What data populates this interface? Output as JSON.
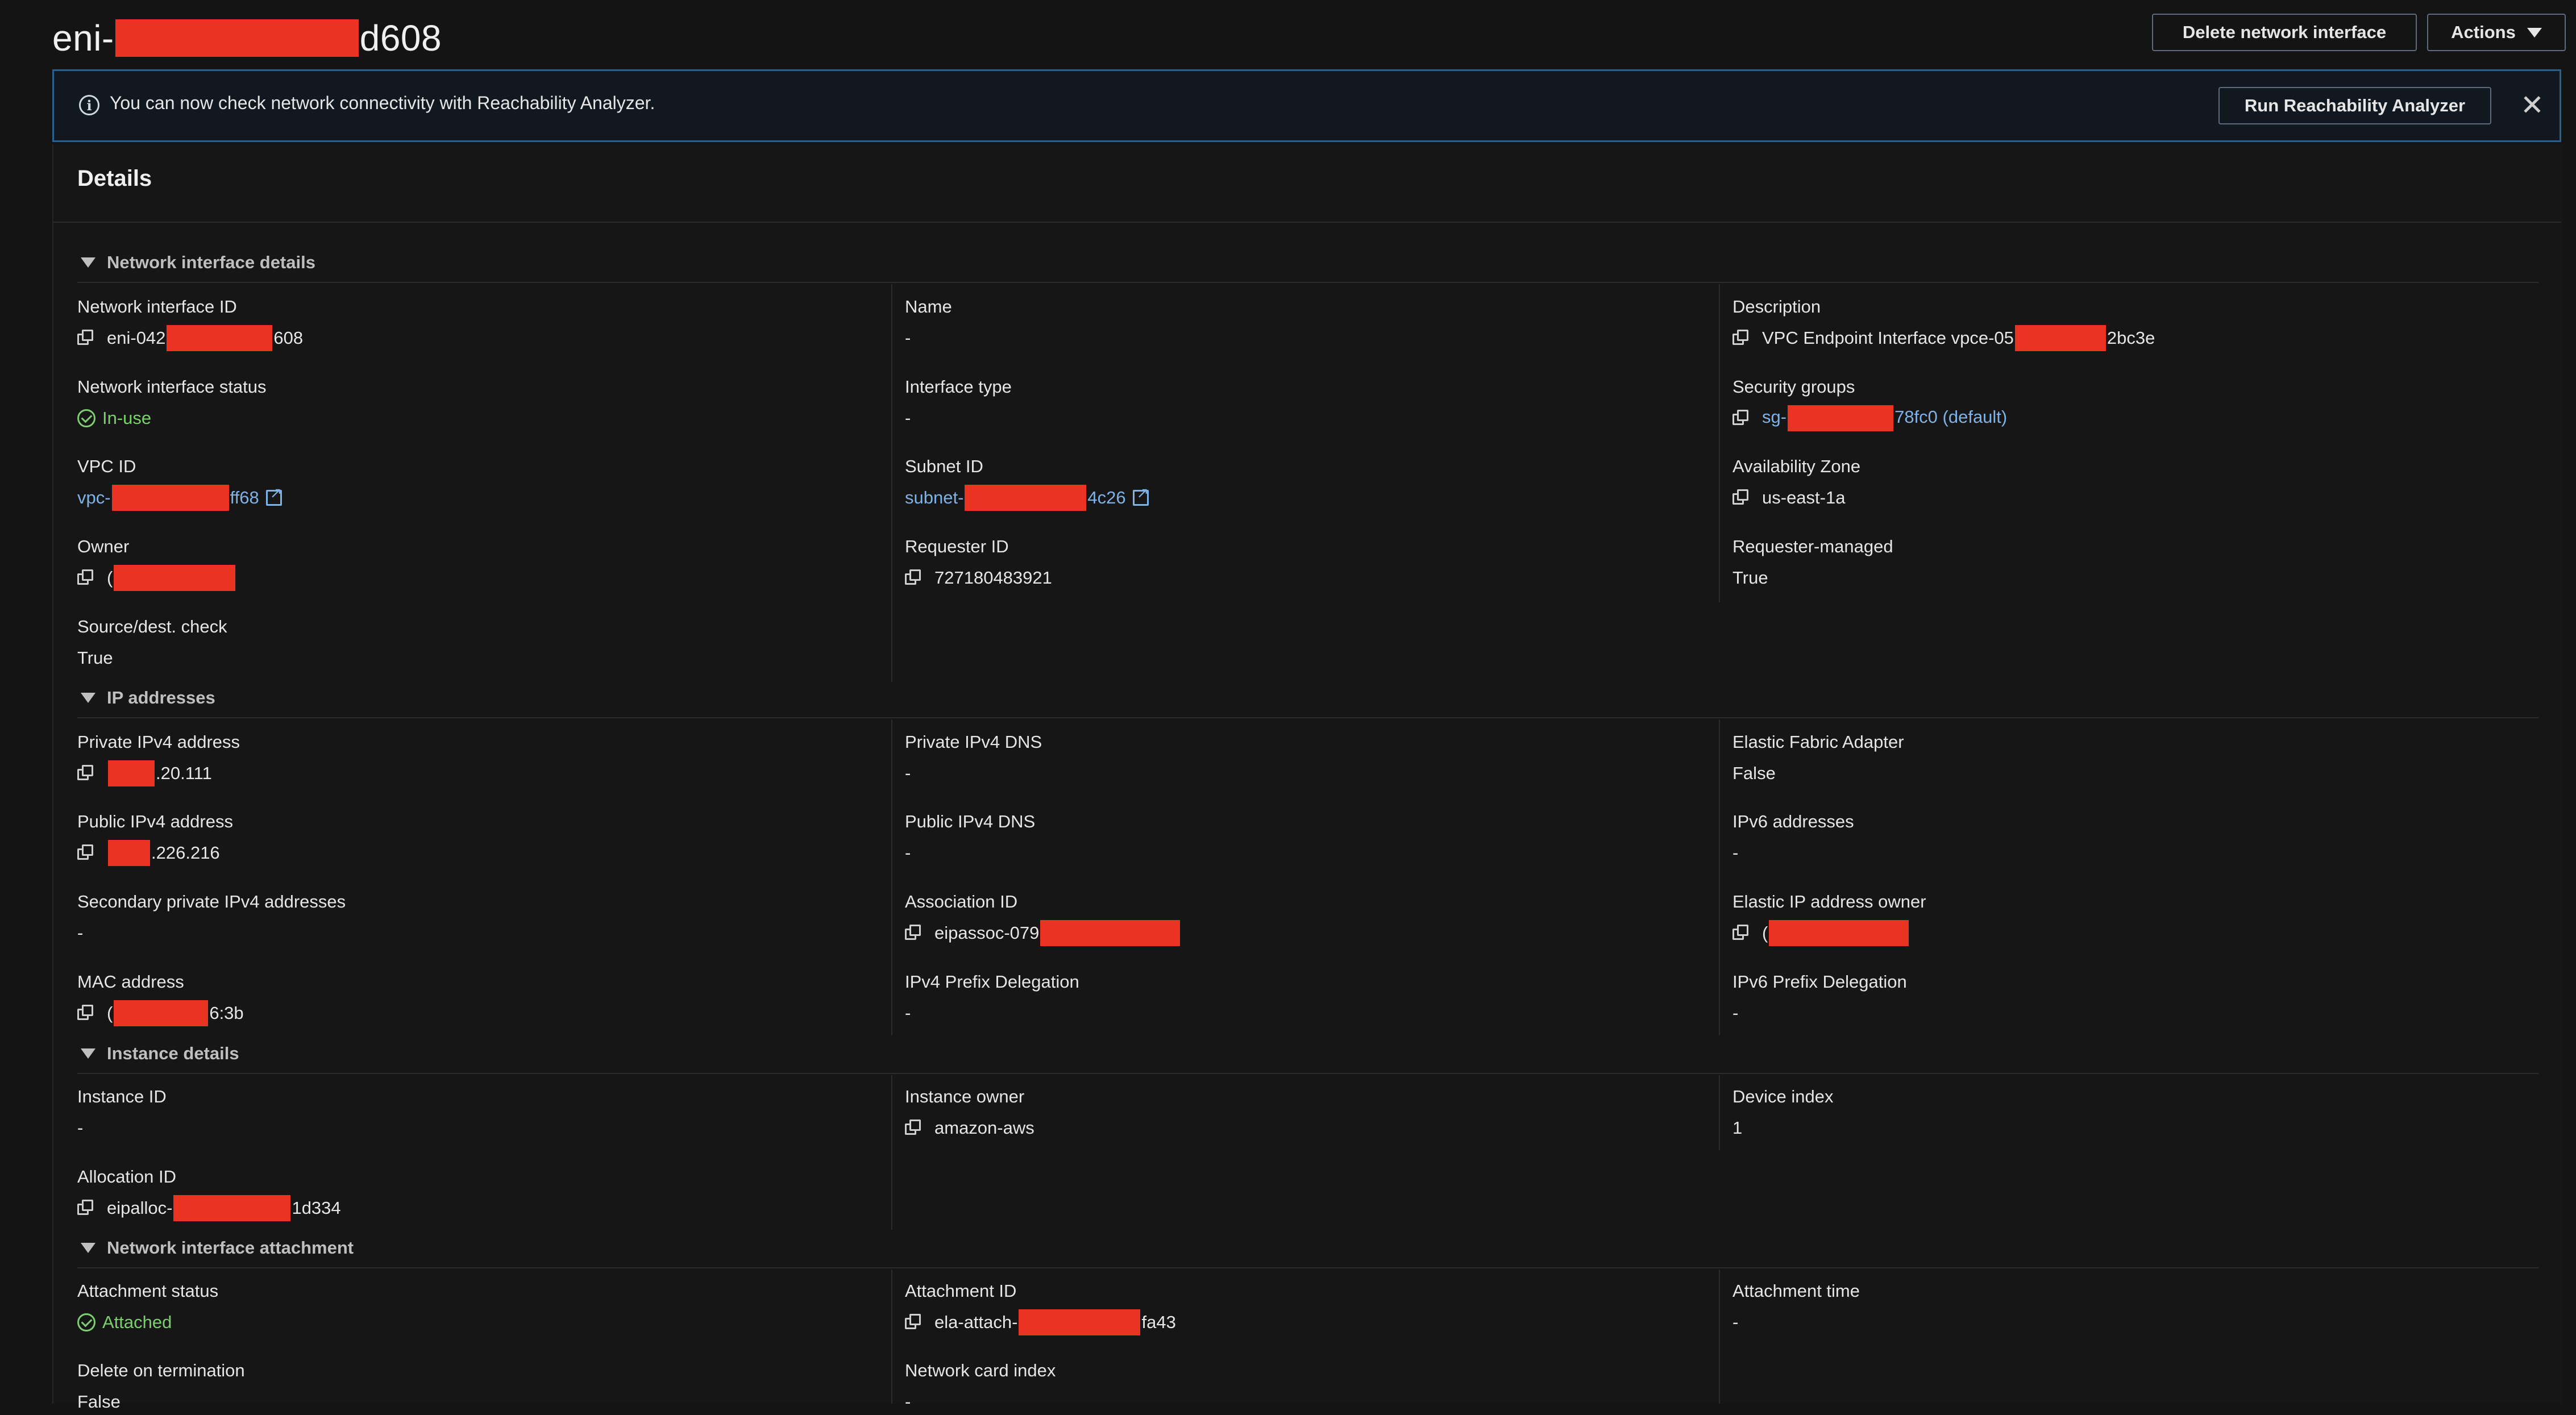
{
  "header": {
    "title_prefix": "eni-",
    "title_suffix": "d608",
    "delete_button": "Delete network interface",
    "actions_button": "Actions"
  },
  "banner": {
    "message": "You can now check network connectivity with Reachability Analyzer.",
    "run_button": "Run Reachability Analyzer"
  },
  "details_title": "Details",
  "sections": {
    "network_interface_details": "Network interface details",
    "ip_addresses": "IP addresses",
    "instance_details": "Instance details",
    "network_interface_attachment": "Network interface attachment"
  },
  "fields": {
    "network_interface_id": {
      "label": "Network interface ID",
      "pre": "eni-042",
      "post": "608"
    },
    "name": {
      "label": "Name",
      "value": "-"
    },
    "description": {
      "label": "Description",
      "pre": "VPC Endpoint Interface vpce-05",
      "post": "2bc3e"
    },
    "status": {
      "label": "Network interface status",
      "value": "In-use"
    },
    "interface_type": {
      "label": "Interface type",
      "value": "-"
    },
    "security_groups": {
      "label": "Security groups",
      "pre": "sg-",
      "post": "78fc0 (default)"
    },
    "vpc_id": {
      "label": "VPC ID",
      "pre": "vpc-",
      "post": "ff68"
    },
    "subnet_id": {
      "label": "Subnet ID",
      "pre": "subnet-",
      "post": "4c26"
    },
    "availability_zone": {
      "label": "Availability Zone",
      "value": "us-east-1a"
    },
    "owner": {
      "label": "Owner",
      "pre": "("
    },
    "requester_id": {
      "label": "Requester ID",
      "value": "727180483921"
    },
    "requester_managed": {
      "label": "Requester-managed",
      "value": "True"
    },
    "source_dest_check": {
      "label": "Source/dest. check",
      "value": "True"
    },
    "private_ipv4": {
      "label": "Private IPv4 address",
      "post": ".20.111"
    },
    "private_ipv4_dns": {
      "label": "Private IPv4 DNS",
      "value": "-"
    },
    "efa": {
      "label": "Elastic Fabric Adapter",
      "value": "False"
    },
    "public_ipv4": {
      "label": "Public IPv4 address",
      "post": ".226.216"
    },
    "public_ipv4_dns": {
      "label": "Public IPv4 DNS",
      "value": "-"
    },
    "ipv6_addresses": {
      "label": "IPv6 addresses",
      "value": "-"
    },
    "secondary_private_ipv4": {
      "label": "Secondary private IPv4 addresses",
      "value": "-"
    },
    "association_id": {
      "label": "Association ID",
      "pre": "eipassoc-079"
    },
    "eip_owner": {
      "label": "Elastic IP address owner",
      "pre": "("
    },
    "mac_address": {
      "label": "MAC address",
      "pre": "(",
      "post": "6:3b"
    },
    "ipv4_prefix_delegation": {
      "label": "IPv4 Prefix Delegation",
      "value": "-"
    },
    "ipv6_prefix_delegation": {
      "label": "IPv6 Prefix Delegation",
      "value": "-"
    },
    "instance_id": {
      "label": "Instance ID",
      "value": "-"
    },
    "instance_owner": {
      "label": "Instance owner",
      "value": "amazon-aws"
    },
    "device_index": {
      "label": "Device index",
      "value": "1"
    },
    "allocation_id": {
      "label": "Allocation ID",
      "pre": "eipalloc-",
      "post": "1d334"
    },
    "attachment_status": {
      "label": "Attachment status",
      "value": "Attached"
    },
    "attachment_id": {
      "label": "Attachment ID",
      "pre": "ela-attach-",
      "post": "fa43"
    },
    "attachment_time": {
      "label": "Attachment time",
      "value": "-"
    },
    "delete_on_termination": {
      "label": "Delete on termination",
      "value": "False"
    },
    "network_card_index": {
      "label": "Network card index",
      "value": "-"
    }
  },
  "colors": {
    "background": "#141414",
    "link": "#7fb2e6",
    "success": "#7ccf6f",
    "redaction": "#ea3323",
    "banner_border": "#2a5f8f"
  }
}
